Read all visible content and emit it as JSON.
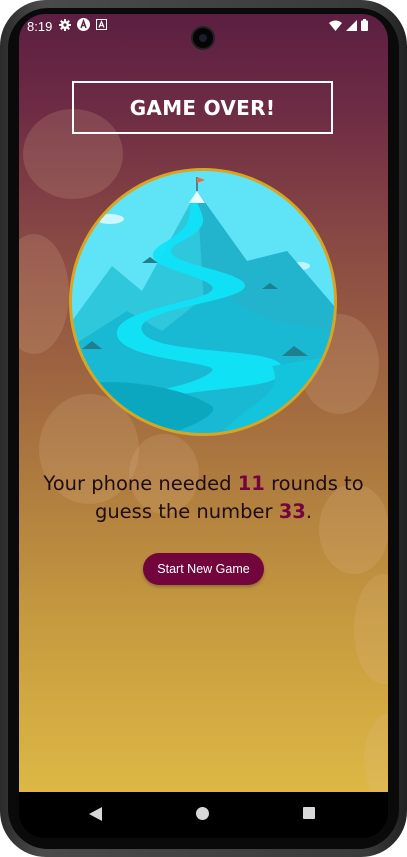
{
  "status_bar": {
    "time": "8:19",
    "left_icons": [
      "gear-icon",
      "android-a-icon",
      "a-box-icon"
    ],
    "right_icons": [
      "wifi-icon",
      "signal-icon",
      "battery-icon"
    ]
  },
  "game_over": {
    "title": "GAME OVER!",
    "summary_prefix": "Your phone needed ",
    "rounds": "11",
    "summary_middle": " rounds to guess the number ",
    "number": "33",
    "summary_suffix": ".",
    "button_label": "Start New Game"
  },
  "colors": {
    "accent": "#72063c",
    "gradient_top": "#5c1f42",
    "gradient_bottom": "#ddb845",
    "image_border": "#d9a520"
  },
  "nav_bar": {
    "icons": [
      "back-icon",
      "home-icon",
      "recents-icon"
    ]
  }
}
